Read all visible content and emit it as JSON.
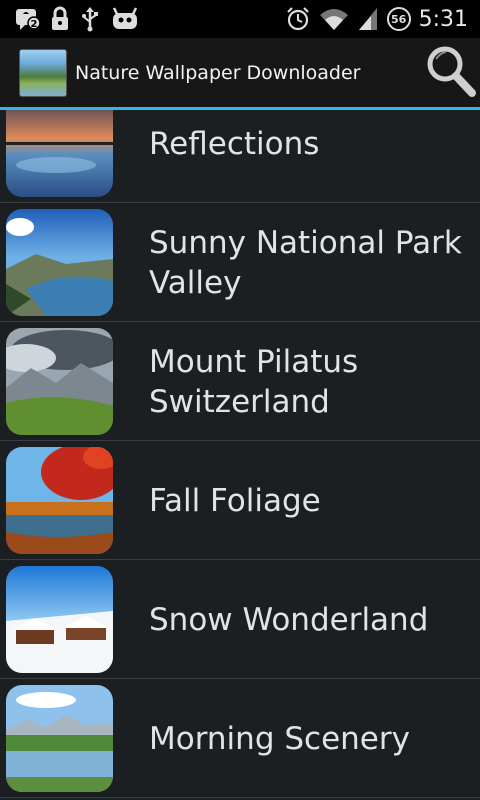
{
  "status_bar": {
    "notification_count": "2",
    "battery_level": "56",
    "time": "5:31"
  },
  "action_bar": {
    "title": "Nature Wallpaper Downloader"
  },
  "wallpapers": [
    {
      "title": "Reflections"
    },
    {
      "title": "Sunny National Park Valley"
    },
    {
      "title": "Mount Pilatus Switzerland"
    },
    {
      "title": "Fall Foliage"
    },
    {
      "title": "Snow Wonderland"
    },
    {
      "title": "Morning Scenery"
    }
  ],
  "colors": {
    "accent": "#33b5e5",
    "background": "#1c1f22",
    "text": "#e3e3e3"
  }
}
